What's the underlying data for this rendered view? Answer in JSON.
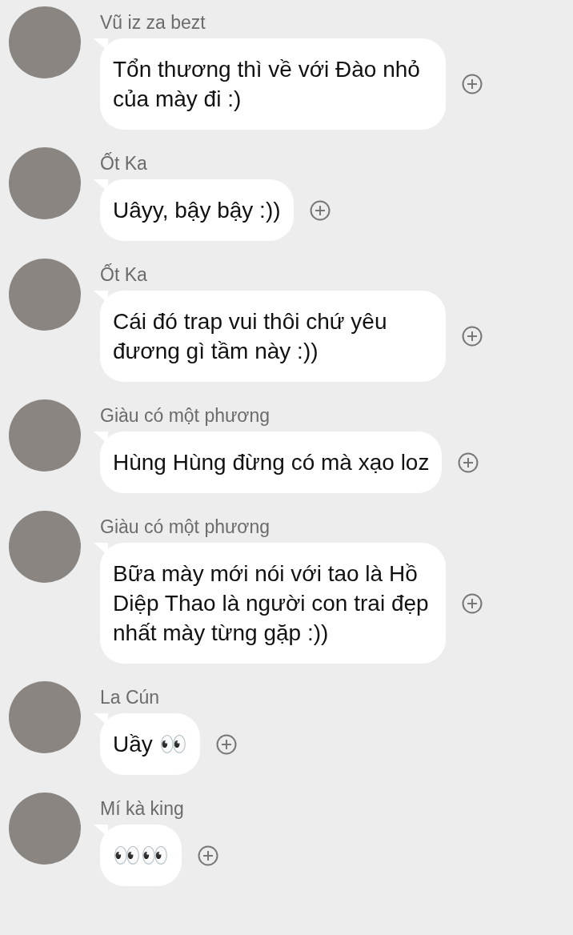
{
  "messages": [
    {
      "sender": "Vũ iz za bezt",
      "text": "Tổn thương thì về với Đào nhỏ của mày đi :)"
    },
    {
      "sender": "Ốt Ka",
      "text": "Uâyy, bậy bậy :))"
    },
    {
      "sender": "Ốt Ka",
      "text": "Cái đó trap vui thôi chứ yêu đương gì tầm này :))"
    },
    {
      "sender": "Giàu có một phương",
      "text": "Hùng Hùng đừng có mà xạo loz"
    },
    {
      "sender": "Giàu có một phương",
      "text": "Bữa mày mới nói với tao là Hồ Diệp Thao là người con trai đẹp nhất mày từng gặp :))"
    },
    {
      "sender": "La Cún",
      "text": "Uầy 👀"
    },
    {
      "sender": "Mí kà king",
      "text": "👀👀"
    }
  ]
}
